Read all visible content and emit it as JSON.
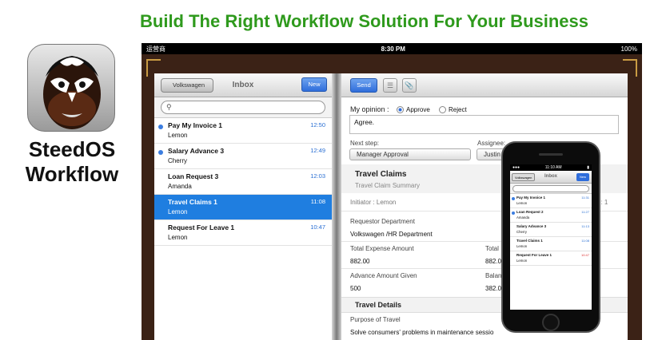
{
  "headline": "Build The Right Workflow Solution For Your Business",
  "brand": {
    "line1": "SteedOS",
    "line2": "Workflow"
  },
  "ipad": {
    "status": {
      "carrier": "运营商",
      "time": "8:30 PM",
      "battery": "100%"
    },
    "left": {
      "back_label": "Volkswagen",
      "title": "Inbox",
      "new_label": "New",
      "messages": [
        {
          "title": "Pay My Invoice 1",
          "from": "Lemon",
          "time": "12:50",
          "unread": true
        },
        {
          "title": "Salary Advance 3",
          "from": "Cherry",
          "time": "12:49",
          "unread": true
        },
        {
          "title": "Loan Request 3",
          "from": "Amanda",
          "time": "12:03",
          "unread": false
        },
        {
          "title": "Travel Claims 1",
          "from": "Lemon",
          "time": "11:08",
          "unread": false
        },
        {
          "title": "Request For Leave 1",
          "from": "Lemon",
          "time": "10:47",
          "unread": false
        }
      ]
    },
    "right": {
      "send_label": "Send",
      "opinion_label": "My opinion :",
      "approve_label": "Approve",
      "reject_label": "Reject",
      "comment": "Agree.",
      "next_step_label": "Next step:",
      "next_step_value": "Manager Approval",
      "assignee_label": "Assignee:",
      "assignee_value": "Justin",
      "form_title": "Travel Claims",
      "form_subtitle": "Travel Claim Summary",
      "initiator": "Initiator : Lemon",
      "no_label": "No : 1",
      "dept_label": "Requestor Department",
      "dept_value": "Volkswagen /HR Department",
      "total_label": "Total Expense Amount",
      "total_value": "882.00",
      "total2_label": "Total",
      "advance_label": "Advance Amount Given",
      "advance_value": "500",
      "balance_label": "Balan",
      "balance_value": "382.0",
      "details_label": "Travel Details",
      "purpose_label": "Purpose of Travel",
      "purpose_value": "Solve consumers' problems in maintenance sessio"
    }
  },
  "iphone": {
    "time": "11:10 AM",
    "back_label": "Volkswagen",
    "title": "Inbox",
    "new_label": "New",
    "messages": [
      {
        "title": "Pay My Invoice 1",
        "from": "Lemon",
        "time": "11:31",
        "unread": true
      },
      {
        "title": "Loan Request 2",
        "from": "Amanda",
        "time": "11:27",
        "unread": true
      },
      {
        "title": "Salary Advance 3",
        "from": "Cherry",
        "time": "11:13",
        "unread": false
      },
      {
        "title": "Travel Claims 1",
        "from": "Lemon",
        "time": "11:08",
        "unread": false
      },
      {
        "title": "Request For Leave 1",
        "from": "Lemon",
        "time": "10:47",
        "unread": false
      }
    ]
  }
}
